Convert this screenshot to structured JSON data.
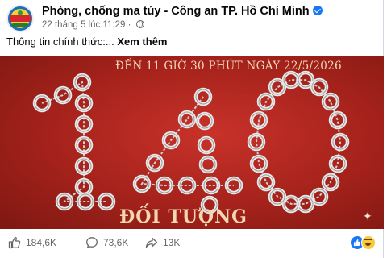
{
  "post": {
    "page_name": "Phòng, chống ma túy - Công an TP. Hồ Chí Minh",
    "timestamp": "22 tháng 5 lúc 11:29 ·",
    "text": "Thông tin chính thức:...",
    "see_more": "Xem thêm"
  },
  "image": {
    "headline": "ĐẾN 11 GIỜ 30 PHÚT NGÀY 22/5/2026",
    "number": "140",
    "caption": "ĐỐI TƯỢNG"
  },
  "footer": {
    "likes": "184,6K",
    "comments": "73,6K",
    "shares": "13K"
  },
  "icons": {
    "verified": "verified-badge-icon",
    "audience": "globe-icon",
    "like": "thumbs-up-icon",
    "comment": "comment-bubble-icon",
    "share": "share-arrow-icon",
    "reactions": [
      "like-reaction-icon",
      "haha-reaction-icon"
    ]
  },
  "colors": {
    "brand_blue": "#1877f2",
    "image_red": "#a4221b",
    "text_secondary": "#65676b",
    "caption_gold": "#f1d7b3"
  }
}
